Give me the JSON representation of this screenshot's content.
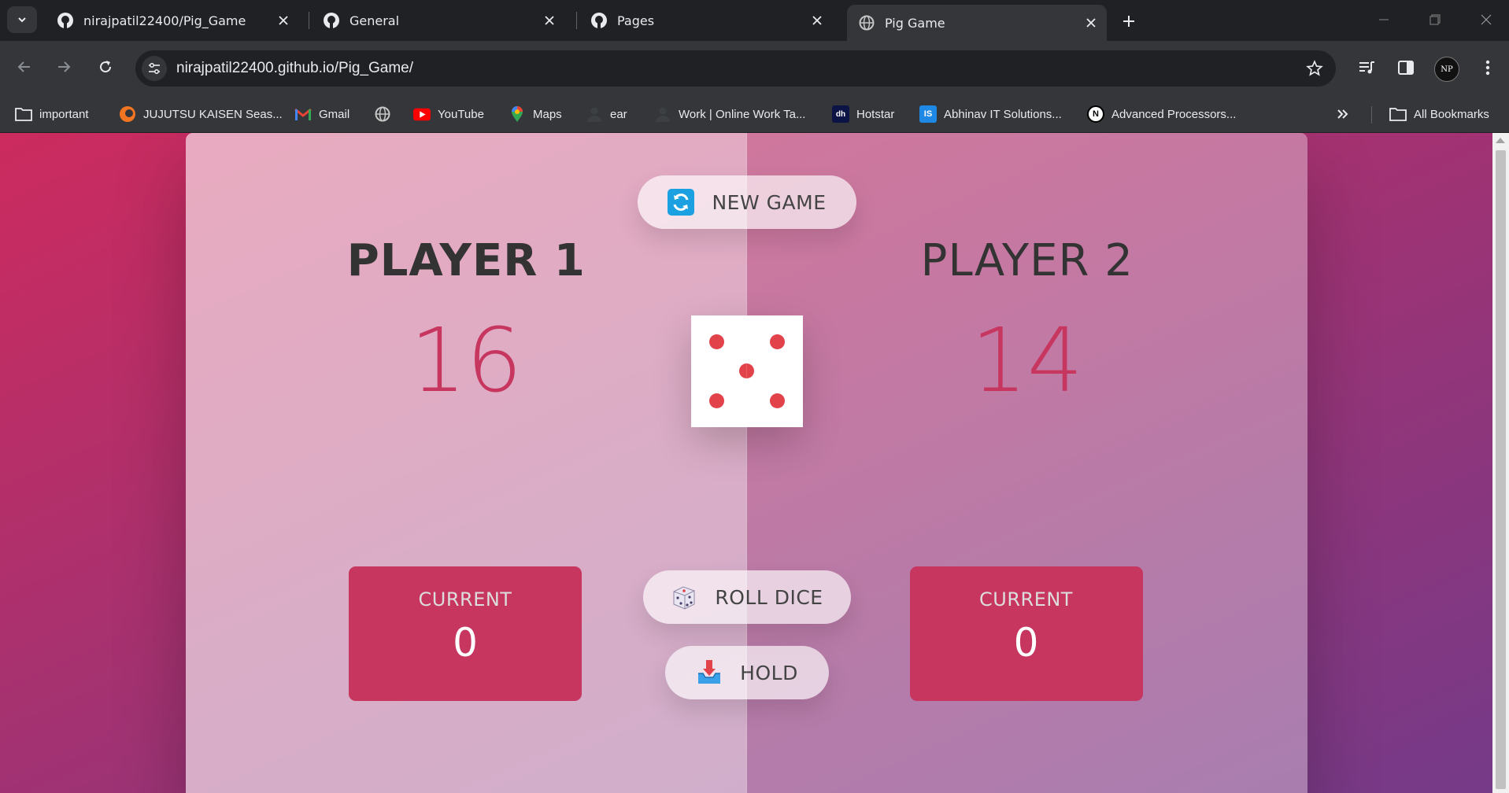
{
  "browser": {
    "tabs": [
      {
        "title": "nirajpatil22400/Pig_Game",
        "icon": "github-icon",
        "active": false
      },
      {
        "title": "General",
        "icon": "github-icon",
        "active": false
      },
      {
        "title": "Pages",
        "icon": "github-icon",
        "active": false
      },
      {
        "title": "Pig Game",
        "icon": "globe-icon",
        "active": true
      }
    ],
    "url": "nirajpatil22400.github.io/Pig_Game/",
    "avatar_initials": "NP",
    "bookmarks": [
      {
        "label": "important",
        "icon": "folder-icon"
      },
      {
        "label": "JUJUTSU KAISEN Seas...",
        "icon": "crunchyroll-icon"
      },
      {
        "label": "Gmail",
        "icon": "gmail-icon"
      },
      {
        "label": "",
        "icon": "globe-icon"
      },
      {
        "label": "YouTube",
        "icon": "youtube-icon"
      },
      {
        "label": "Maps",
        "icon": "maps-icon"
      },
      {
        "label": "ear",
        "icon": "person-icon"
      },
      {
        "label": "Work | Online Work Ta...",
        "icon": "person-icon"
      },
      {
        "label": "Hotstar",
        "icon": "hotstar-icon"
      },
      {
        "label": "Abhinav IT Solutions...",
        "icon": "is-icon"
      },
      {
        "label": "Advanced Processors...",
        "icon": "notion-icon"
      }
    ],
    "all_bookmarks_label": "All Bookmarks",
    "colors": {
      "frame": "#202124",
      "toolbar": "#35363a",
      "text": "#e8eaed"
    }
  },
  "game": {
    "new_game_label": "NEW GAME",
    "roll_dice_label": "ROLL DICE",
    "hold_label": "HOLD",
    "dice_value": 5,
    "players": [
      {
        "name": "PLAYER 1",
        "score": "16",
        "current_label": "CURRENT",
        "current_score": "0",
        "active": true
      },
      {
        "name": "PLAYER 2",
        "score": "14",
        "current_label": "CURRENT",
        "current_score": "0",
        "active": false
      }
    ],
    "colors": {
      "accent": "#c7365f",
      "pip": "#e2434b",
      "gradient_start": "#cc2b5e",
      "gradient_end": "#753a88"
    }
  }
}
